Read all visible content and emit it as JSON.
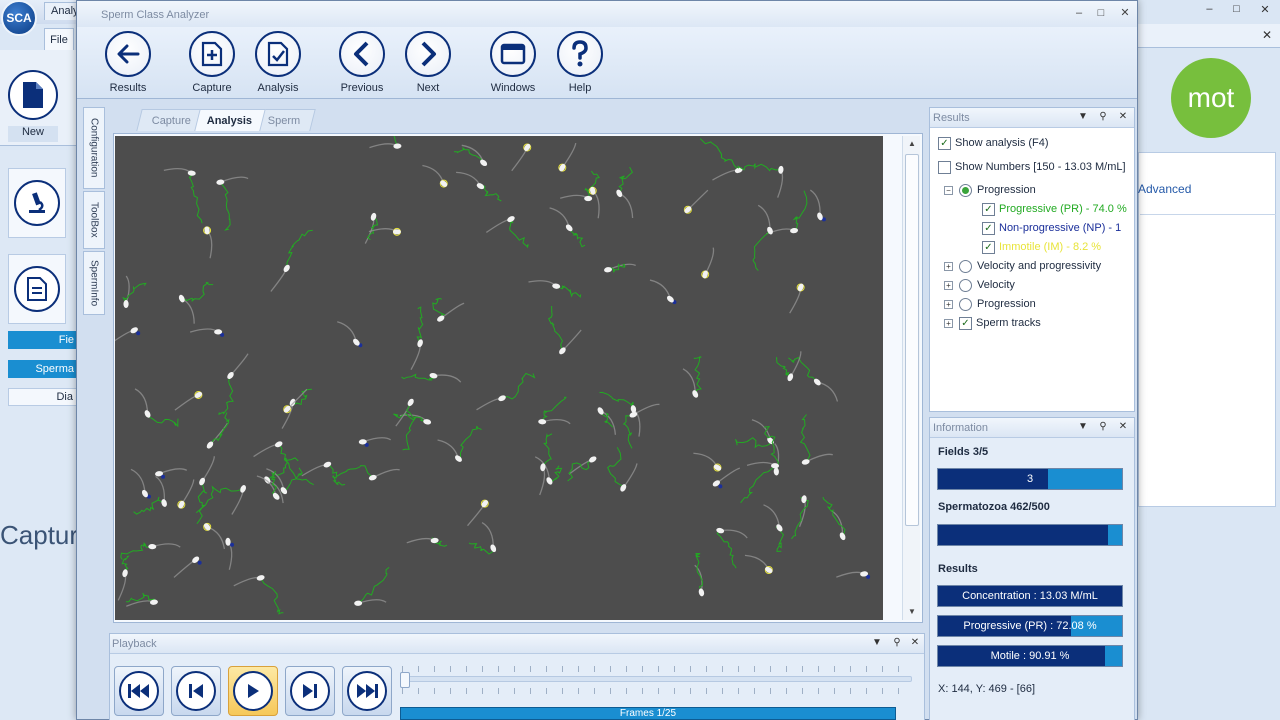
{
  "background_app": {
    "logo_text": "SCA",
    "tab_label": "Analy",
    "file_tab": "File",
    "new_label": "New",
    "side_buttons": [
      "Fie",
      "Sperma",
      "Dia"
    ],
    "captur_text": "Captur",
    "mot_text": "mot",
    "advanced_label": "Advanced"
  },
  "window": {
    "title": "Sperm Class Analyzer",
    "controls": {
      "minimize": "–",
      "maximize": "□",
      "close": "✕"
    }
  },
  "toolbar": {
    "buttons": [
      {
        "label": "Results",
        "icon": "arrow-left-icon"
      },
      {
        "label": "Capture",
        "icon": "capture-plus-icon"
      },
      {
        "label": "Analysis",
        "icon": "analysis-check-icon"
      },
      {
        "label": "Previous",
        "icon": "chevron-left-icon"
      },
      {
        "label": "Next",
        "icon": "chevron-right-icon"
      },
      {
        "label": "Windows",
        "icon": "window-icon"
      },
      {
        "label": "Help",
        "icon": "help-icon"
      }
    ]
  },
  "side_tabs": [
    "Configuration",
    "ToolBox",
    "SpermInfo"
  ],
  "view_tabs": [
    {
      "label": "Capture",
      "active": false
    },
    {
      "label": "Analysis",
      "active": true
    },
    {
      "label": "Sperm",
      "active": false
    }
  ],
  "playback": {
    "title": "Playback",
    "frames_label": "Frames 1/25",
    "buttons": [
      "skip-first-icon",
      "step-back-icon",
      "play-icon",
      "step-forward-icon",
      "skip-last-icon"
    ]
  },
  "results": {
    "title": "Results",
    "show_analysis": "Show analysis (F4)",
    "show_numbers": "Show Numbers [150 - 13.03 M/mL]",
    "tree": {
      "progression": "Progression",
      "progressive": "Progressive (PR) - 74.0 %",
      "non_progressive": "Non-progressive (NP) - 1",
      "immotile": "Immotile (IM) - 8.2 %",
      "velocity_progressivity": "Velocity and progressivity",
      "velocity": "Velocity",
      "progression2": "Progression",
      "sperm_tracks": "Sperm tracks"
    },
    "colors": {
      "progressive": "#22aa22",
      "non_progressive": "#1b2f9a",
      "immotile": "#e8e43a"
    }
  },
  "information": {
    "title": "Information",
    "fields_label": "Fields 3/5",
    "fields_bar_text": "3",
    "fields_fill": 0.6,
    "spermatozoa_label": "Spermatozoa 462/500",
    "spermatozoa_fill": 0.924,
    "results_label": "Results",
    "concentration": "Concentration : 13.03 M/mL",
    "concentration_fill": 1.0,
    "progressive": "Progressive (PR) : 72.08 %",
    "progressive_fill": 0.7208,
    "motile": "Motile : 90.91 %",
    "motile_fill": 0.9091,
    "coords": "X: 144, Y: 469 - [66]"
  }
}
